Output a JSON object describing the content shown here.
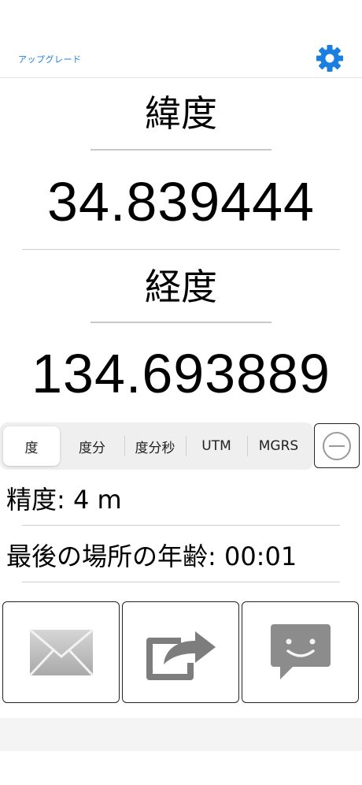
{
  "header": {
    "upgrade_label": "アップグレード",
    "settings_icon": "gear-icon",
    "accent_color": "#1a7fe0"
  },
  "latitude": {
    "label": "緯度",
    "value": "34.839444"
  },
  "longitude": {
    "label": "経度",
    "value": "134.693889"
  },
  "format_tabs": {
    "items": [
      "度",
      "度分",
      "度分秒",
      "UTM",
      "MGRS"
    ],
    "selected": "度"
  },
  "accuracy": {
    "text": "精度: 4 m"
  },
  "last_location_age": {
    "text": "最後の場所の年齢: 00:01"
  },
  "actions": {
    "email_icon": "envelope-icon",
    "share_icon": "share-icon",
    "message_icon": "message-icon"
  }
}
